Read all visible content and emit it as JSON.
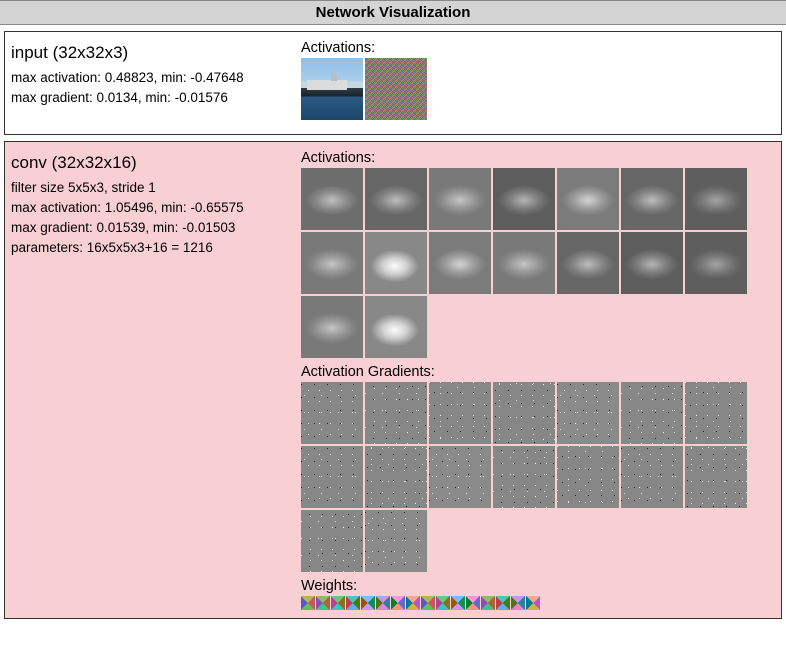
{
  "header": {
    "title": "Network Visualization"
  },
  "layers": {
    "input": {
      "title": "input (32x32x3)",
      "stats": [
        "max activation: 0.48823, min: -0.47648",
        "max gradient: 0.0134, min: -0.01576"
      ],
      "sections": {
        "activations_label": "Activations:"
      },
      "activation_count": 2
    },
    "conv": {
      "title": "conv (32x32x16)",
      "stats": [
        "filter size 5x5x3, stride 1",
        "max activation: 1.05496, min: -0.65575",
        "max gradient: 0.01539, min: -0.01503",
        "parameters: 16x5x5x3+16 = 1216"
      ],
      "sections": {
        "activations_label": "Activations:",
        "gradients_label": "Activation Gradients:",
        "weights_label": "Weights:"
      },
      "activation_count": 16,
      "gradient_count": 16,
      "weight_count": 16
    }
  }
}
